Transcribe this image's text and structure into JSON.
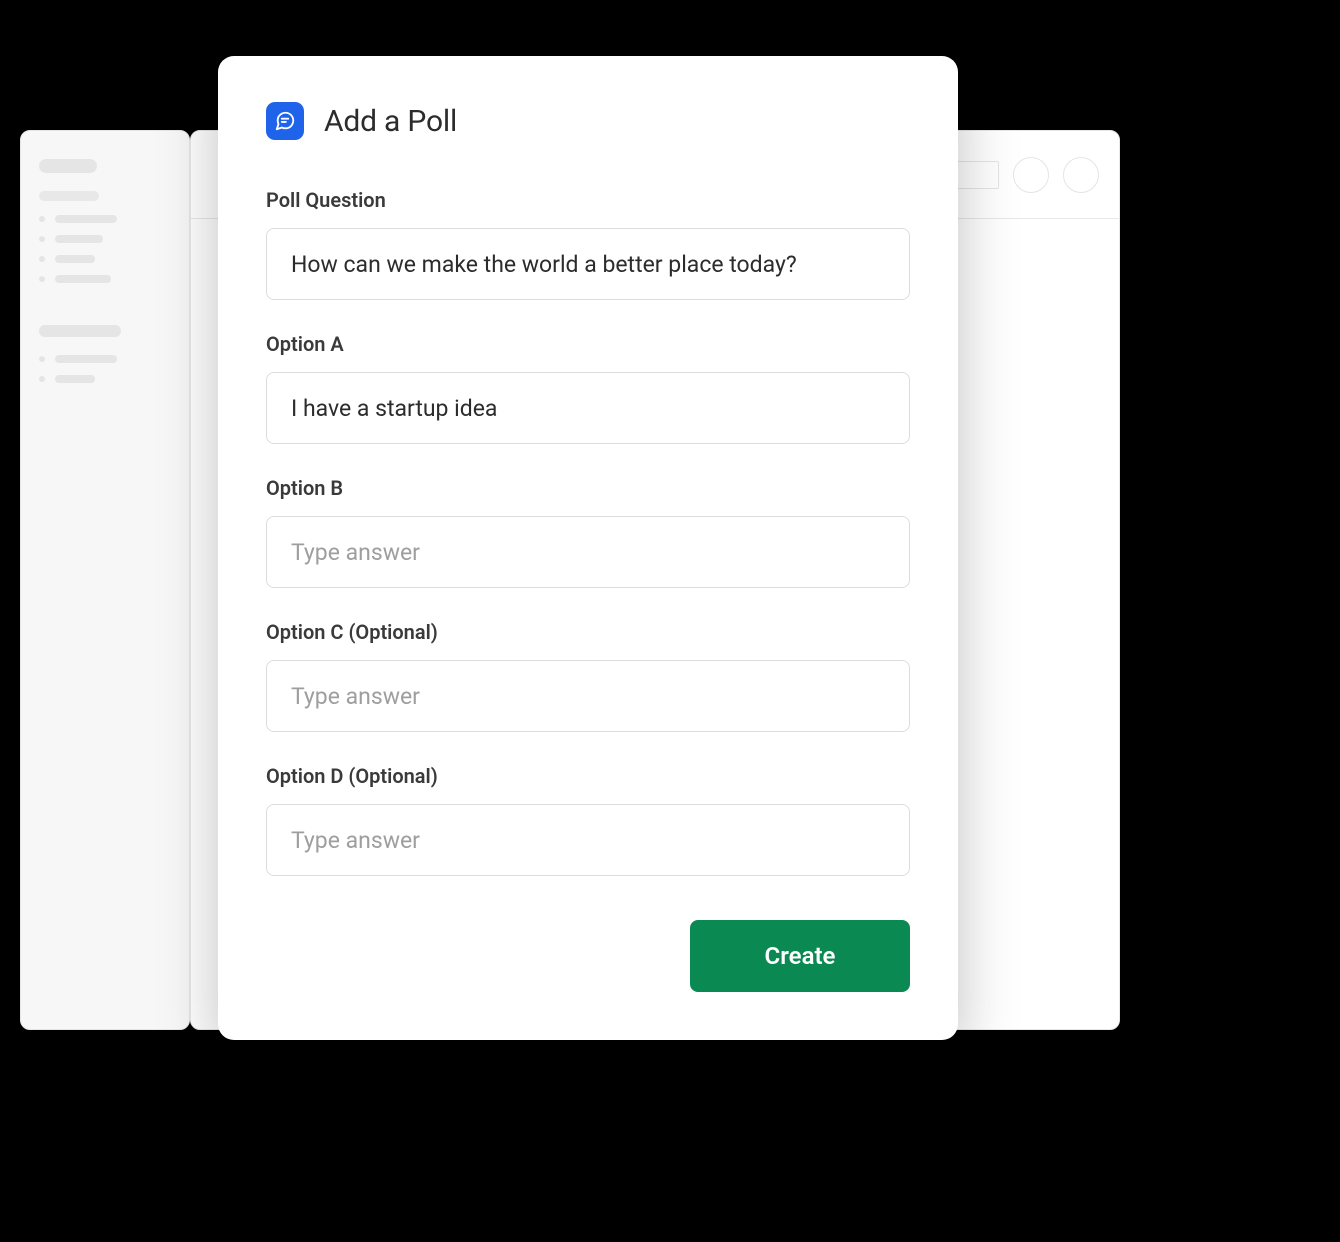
{
  "modal": {
    "title": "Add a Poll",
    "question": {
      "label": "Poll Question",
      "value": "How can we make the world a better place today?"
    },
    "options": {
      "a": {
        "label": "Option A",
        "value": "I have a startup idea",
        "placeholder": ""
      },
      "b": {
        "label": "Option B",
        "value": "",
        "placeholder": "Type answer"
      },
      "c": {
        "label": "Option C (Optional)",
        "value": "",
        "placeholder": "Type answer"
      },
      "d": {
        "label": "Option D (Optional)",
        "value": "",
        "placeholder": "Type answer"
      }
    },
    "submit_label": "Create"
  }
}
